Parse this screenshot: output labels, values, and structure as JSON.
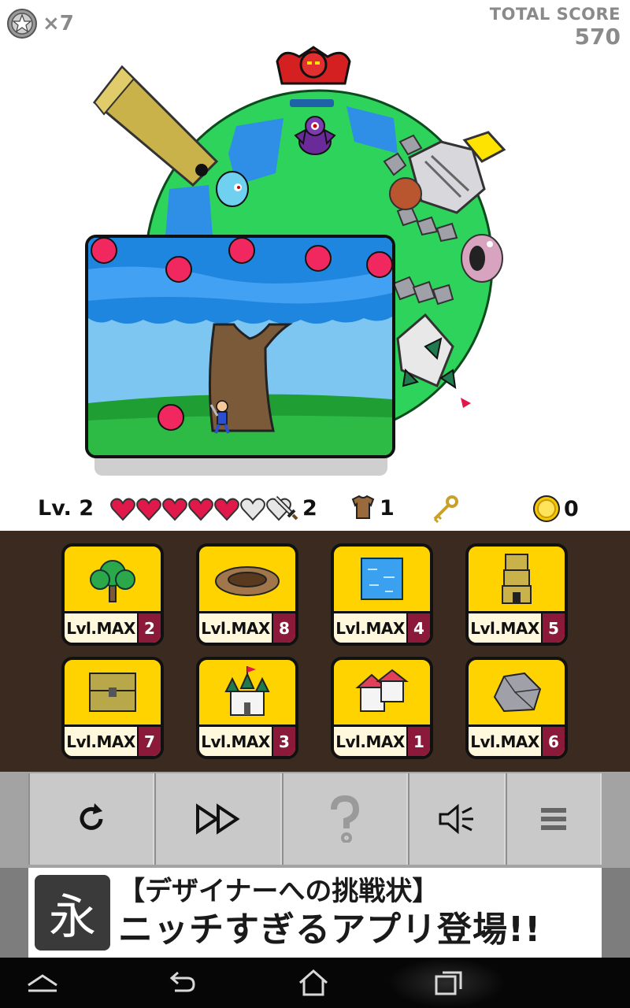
{
  "header": {
    "star_multiplier": "×7",
    "total_score_label": "TOTAL SCORE",
    "total_score_value": "570"
  },
  "status": {
    "level": "Lv. 2",
    "hearts_total": 7,
    "hearts_filled": 5,
    "sword_count": "2",
    "armor_count": "1",
    "coin_count": "0",
    "icons": [
      "heart-icon",
      "sword-icon",
      "armor-icon",
      "key-icon",
      "coin-icon"
    ]
  },
  "buildings": [
    {
      "icon": "tree-icon",
      "level": "Lvl.MAX",
      "count": "2"
    },
    {
      "icon": "hole-icon",
      "level": "Lvl.MAX",
      "count": "8"
    },
    {
      "icon": "pond-icon",
      "level": "Lvl.MAX",
      "count": "4"
    },
    {
      "icon": "tower-icon",
      "level": "Lvl.MAX",
      "count": "5"
    },
    {
      "icon": "chest-icon",
      "level": "Lvl.MAX",
      "count": "7"
    },
    {
      "icon": "castle-icon",
      "level": "Lvl.MAX",
      "count": "3"
    },
    {
      "icon": "house-icon",
      "level": "Lvl.MAX",
      "count": "1"
    },
    {
      "icon": "rock-icon",
      "level": "Lvl.MAX",
      "count": "6"
    }
  ],
  "controls": [
    {
      "icon": "reload-icon"
    },
    {
      "icon": "fast-forward-icon"
    },
    {
      "icon": "help-icon"
    },
    {
      "icon": "sound-icon"
    },
    {
      "icon": "menu-icon"
    }
  ],
  "ad": {
    "logo_char": "永",
    "line1": "【デザイナーへの挑戦状】",
    "line2": "ニッチすぎるアプリ登場!!"
  },
  "colors": {
    "card_yellow": "#ffd300",
    "panel_brown": "#3b2a20",
    "count_badge": "#8b1a3a",
    "planet_green": "#2ed35c",
    "heart_red": "#e0194a"
  }
}
